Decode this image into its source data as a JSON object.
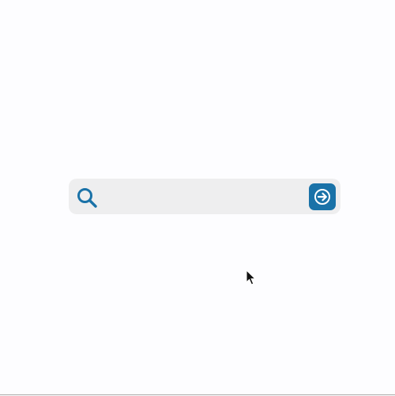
{
  "search": {
    "value": "",
    "placeholder": "",
    "icon": "search-icon",
    "submit_icon": "arrow-right-icon",
    "accent_color": "#1a72a8",
    "field_background": "#eeeeef"
  },
  "cursor": {
    "icon": "mouse-pointer-icon"
  }
}
